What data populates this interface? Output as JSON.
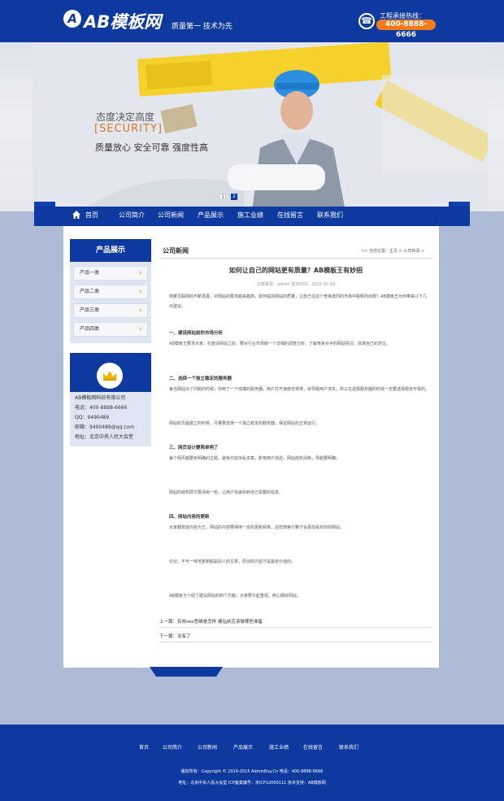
{
  "header": {
    "logo_mark": "A",
    "logo_text": "AB模板网",
    "slogan": "质量第一  技术为先",
    "hotline_label": "工程承接热线：",
    "hotline_number": "400-8888-6666"
  },
  "banner": {
    "line1": "态度决定高度",
    "line2": "[SECURITY]",
    "line3": "质量放心 安全可靠 强度性高",
    "dots": [
      "1",
      "2"
    ]
  },
  "nav": {
    "items": [
      "首页",
      "公司简介",
      "公司新闻",
      "产品展示",
      "施工业绩",
      "在线留言",
      "联系我们"
    ]
  },
  "sidebar": {
    "title": "产品展示",
    "categories": [
      "产品一类",
      "产品二类",
      "产品三类",
      "产品四类"
    ],
    "contact": {
      "company": "AB模板网科技有限公司",
      "phone": "电话：400-8888-6666",
      "qq": "QQ：9490489",
      "email": "邮箱：9490489@qq.com",
      "address": "地址：北京中央人民大会堂"
    }
  },
  "article": {
    "section_title": "公司新闻",
    "breadcrumb": ">> 当前位置：主页 > 公司新闻 >",
    "title": "如何让自己的网站更有质量？AB模板王有妙招",
    "meta": "文章来源：admin  发布时间：2015-05-09",
    "paragraphs": [
      "随着互联网的不断发展，对网站的要求越来越高，如何提高网站的质量，让自己在这个竞争激烈的市场中脱颖而出呢？AB模板王为你带来以下几点建议。",
      "一、建设网站前的市场分析",
      "AB模板王要求大家，在建设网站之前，要对行业市场做一个详细的调查分析，了解竞争对手的网站情况，找准自己的定位。",
      "二、选择一个独立稳定的服务器",
      "每当网站出了问题的时候，你用了一个低廉的服务器，用户打开速度非常慢，会导致用户流失，所以在选择服务器的时候一定要选择稳定可靠的。",
      "网站的页面建立的时候，尽量要选择一个独立稳定的服务器，保证网站的正常运行。",
      "三、网页设计要简单明了",
      "每个网页都要有明确的主题，避免内容杂乱无章，影响用户体验，网站结构清晰，导航要明确。",
      "网站的结构层次要清晰一些，让用户快速找到自己需要的信息。",
      "四、网站内容的更新",
      "大家都知道内容为王，网站的内容要保持一定的更新频率，这样搜索引擎才会更加喜欢你的网站。",
      "切记，不可一味地复制粘贴别人的文章，原创的内容才是最有价值的。",
      "AB模板王介绍了建设网站的四个方面，大家要引起重视，用心做好网站。"
    ],
    "prev": "上一篇：有效seo思维是怎样 建站前应该做哪些准备",
    "next": "下一篇：没有了"
  },
  "footer": {
    "links": [
      "首页",
      "公司简介",
      "公司新闻",
      "产品展示",
      "施工业绩",
      "在线留言",
      "联系我们"
    ],
    "copyright": "版权所有：Copyright © 2014-2015 AdminBuy.Cn   电话：400-8888-6666",
    "address": "地址：北京中央人民大会堂   ICP备案编号：京ICP12000111   技术支持：AB模板网"
  }
}
